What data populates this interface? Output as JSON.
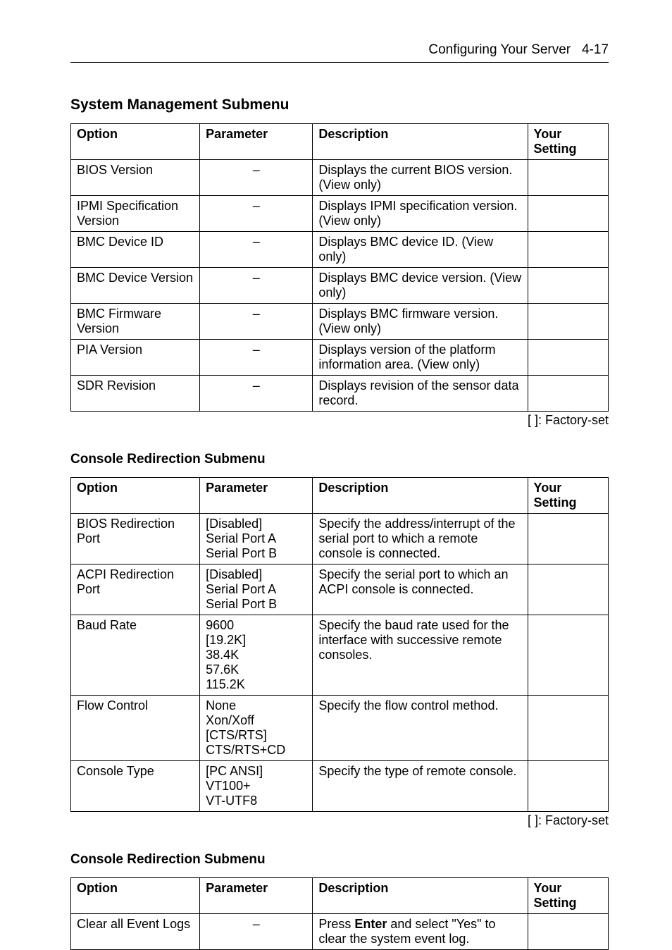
{
  "header": {
    "title": "Configuring Your Server",
    "page": "4-17"
  },
  "sysmgmt": {
    "heading": "System Management Submenu",
    "columns": [
      "Option",
      "Parameter",
      "Description",
      "Your Setting"
    ],
    "rows": [
      {
        "option": "BIOS Version",
        "parameter": "–",
        "description": "Displays the current BIOS version. (View only)",
        "setting": ""
      },
      {
        "option": "IPMI Specification Version",
        "parameter": "–",
        "description": "Displays IPMI specification version. (View only)",
        "setting": ""
      },
      {
        "option": "BMC Device ID",
        "parameter": "–",
        "description": "Displays BMC device ID. (View only)",
        "setting": ""
      },
      {
        "option": "BMC Device Version",
        "parameter": "–",
        "description": "Displays BMC device version. (View only)",
        "setting": ""
      },
      {
        "option": "BMC Firmware Version",
        "parameter": "–",
        "description": "Displays BMC firmware version. (View only)",
        "setting": ""
      },
      {
        "option": "PIA Version",
        "parameter": "–",
        "description": "Displays version of the platform information area. (View only)",
        "setting": ""
      },
      {
        "option": "SDR Revision",
        "parameter": "–",
        "description": "Displays revision of the sensor data record.",
        "setting": ""
      }
    ],
    "footnote": "[      ]: Factory-set"
  },
  "redir1": {
    "heading": "Console Redirection Submenu",
    "columns": [
      "Option",
      "Parameter",
      "Description",
      "Your Setting"
    ],
    "rows": [
      {
        "option": "BIOS Redirection Port",
        "parameter": "[Disabled]\nSerial Port A\nSerial Port B",
        "description": "Specify the address/interrupt of the serial port to which a remote console is connected.",
        "setting": ""
      },
      {
        "option": "ACPI Redirection Port",
        "parameter": "[Disabled]\nSerial Port A\nSerial Port B",
        "description": "Specify the serial port to which an ACPI console is connected.",
        "setting": ""
      },
      {
        "option": "Baud Rate",
        "parameter": "9600\n[19.2K]\n38.4K\n57.6K\n115.2K",
        "description": "Specify the baud rate used for the interface with successive remote consoles.",
        "setting": ""
      },
      {
        "option": "Flow Control",
        "parameter": "None\nXon/Xoff\n[CTS/RTS]\nCTS/RTS+CD",
        "description": "Specify the flow control method.",
        "setting": ""
      },
      {
        "option": "Console Type",
        "parameter": "[PC ANSI]\nVT100+\nVT-UTF8",
        "description": "Specify the type of remote console.",
        "setting": ""
      }
    ],
    "footnote": "[      ]: Factory-set"
  },
  "redir2": {
    "heading": "Console Redirection Submenu",
    "columns": [
      "Option",
      "Parameter",
      "Description",
      "Your Setting"
    ],
    "rows": [
      {
        "option": "Clear all Event Logs",
        "parameter": "–",
        "desc_pre": "Press ",
        "desc_bold": "Enter",
        "desc_post": " and select \"Yes\" to clear the system event log.",
        "setting": ""
      }
    ]
  },
  "chart_data": [
    {
      "type": "table",
      "title": "System Management Submenu",
      "columns": [
        "Option",
        "Parameter",
        "Description",
        "Your Setting"
      ],
      "rows": [
        [
          "BIOS Version",
          "–",
          "Displays the current BIOS version. (View only)",
          ""
        ],
        [
          "IPMI Specification Version",
          "–",
          "Displays IPMI specification version. (View only)",
          ""
        ],
        [
          "BMC Device ID",
          "–",
          "Displays BMC device ID. (View only)",
          ""
        ],
        [
          "BMC Device Version",
          "–",
          "Displays BMC device version. (View only)",
          ""
        ],
        [
          "BMC Firmware Version",
          "–",
          "Displays BMC firmware version. (View only)",
          ""
        ],
        [
          "PIA Version",
          "–",
          "Displays version of the platform information area. (View only)",
          ""
        ],
        [
          "SDR Revision",
          "–",
          "Displays revision of the sensor data record.",
          ""
        ]
      ]
    },
    {
      "type": "table",
      "title": "Console Redirection Submenu",
      "columns": [
        "Option",
        "Parameter",
        "Description",
        "Your Setting"
      ],
      "rows": [
        [
          "BIOS Redirection Port",
          "[Disabled] / Serial Port A / Serial Port B",
          "Specify the address/interrupt of the serial port to which a remote console is connected.",
          ""
        ],
        [
          "ACPI Redirection Port",
          "[Disabled] / Serial Port A / Serial Port B",
          "Specify the serial port to which an ACPI console is connected.",
          ""
        ],
        [
          "Baud Rate",
          "9600 / [19.2K] / 38.4K / 57.6K / 115.2K",
          "Specify the baud rate used for the interface with successive remote consoles.",
          ""
        ],
        [
          "Flow Control",
          "None / Xon/Xoff / [CTS/RTS] / CTS/RTS+CD",
          "Specify the flow control method.",
          ""
        ],
        [
          "Console Type",
          "[PC ANSI] / VT100+ / VT-UTF8",
          "Specify the type of remote console.",
          ""
        ]
      ]
    },
    {
      "type": "table",
      "title": "Console Redirection Submenu",
      "columns": [
        "Option",
        "Parameter",
        "Description",
        "Your Setting"
      ],
      "rows": [
        [
          "Clear all Event Logs",
          "–",
          "Press Enter and select \"Yes\" to clear the system event log.",
          ""
        ]
      ]
    }
  ]
}
